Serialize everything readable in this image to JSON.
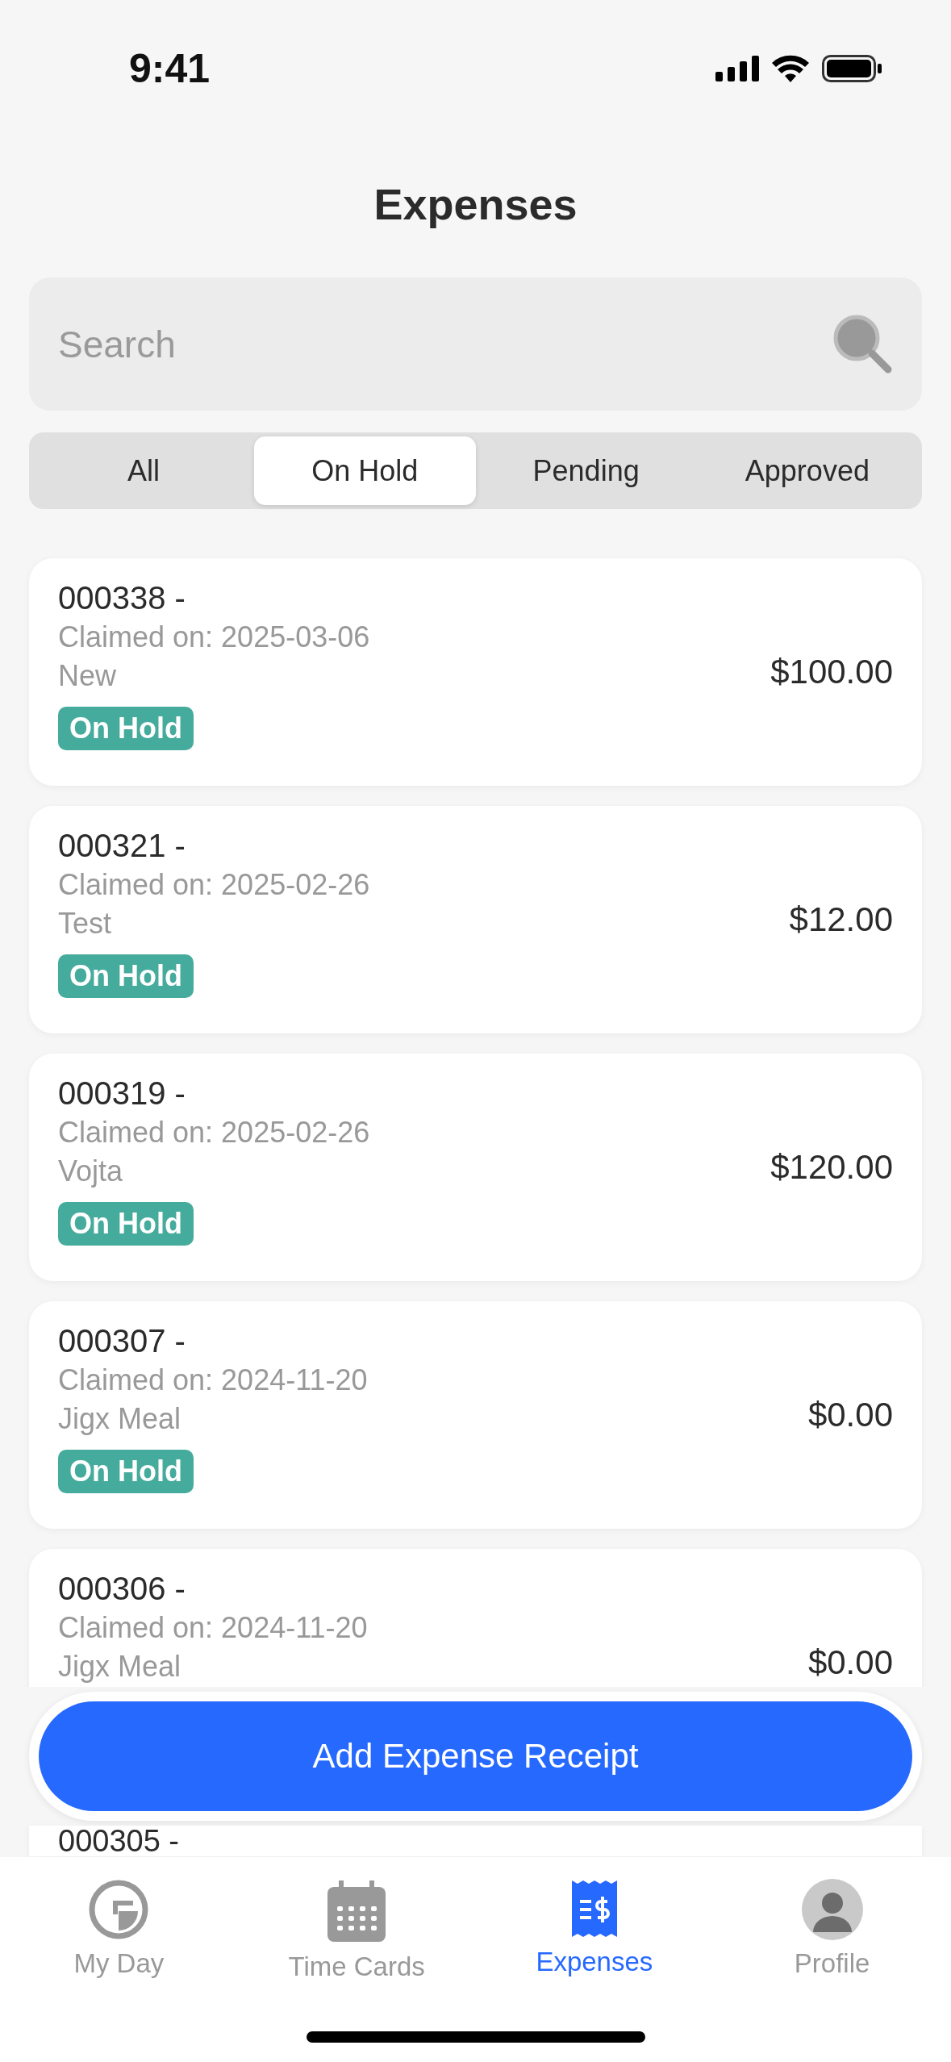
{
  "status_bar": {
    "time": "9:41"
  },
  "title": "Expenses",
  "search": {
    "placeholder": "Search"
  },
  "filters": [
    {
      "label": "All",
      "selected": false
    },
    {
      "label": "On Hold",
      "selected": true
    },
    {
      "label": "Pending",
      "selected": false
    },
    {
      "label": "Approved",
      "selected": false
    }
  ],
  "expenses": [
    {
      "number": "000338 -",
      "claimed": "Claimed on: 2025-03-06",
      "description": "New",
      "amount": "$100.00",
      "status": "On Hold"
    },
    {
      "number": "000321 -",
      "claimed": "Claimed on: 2025-02-26",
      "description": "Test",
      "amount": "$12.00",
      "status": "On Hold"
    },
    {
      "number": "000319 -",
      "claimed": "Claimed on: 2025-02-26",
      "description": "Vojta",
      "amount": "$120.00",
      "status": "On Hold"
    },
    {
      "number": "000307 -",
      "claimed": "Claimed on: 2024-11-20",
      "description": "Jigx Meal",
      "amount": "$0.00",
      "status": "On Hold"
    },
    {
      "number": "000306 -",
      "claimed": "Claimed on: 2024-11-20",
      "description": "Jigx Meal",
      "amount": "$0.00"
    },
    {
      "number": "000305 -"
    }
  ],
  "add_button": "Add Expense Receipt",
  "tab_bar": [
    {
      "kind": "day",
      "label": "My Day",
      "selected": false
    },
    {
      "kind": "calendar",
      "label": "Time Cards",
      "selected": false
    },
    {
      "kind": "receipt",
      "label": "Expenses",
      "selected": true
    },
    {
      "kind": "avatar",
      "label": "Profile",
      "selected": false
    }
  ]
}
